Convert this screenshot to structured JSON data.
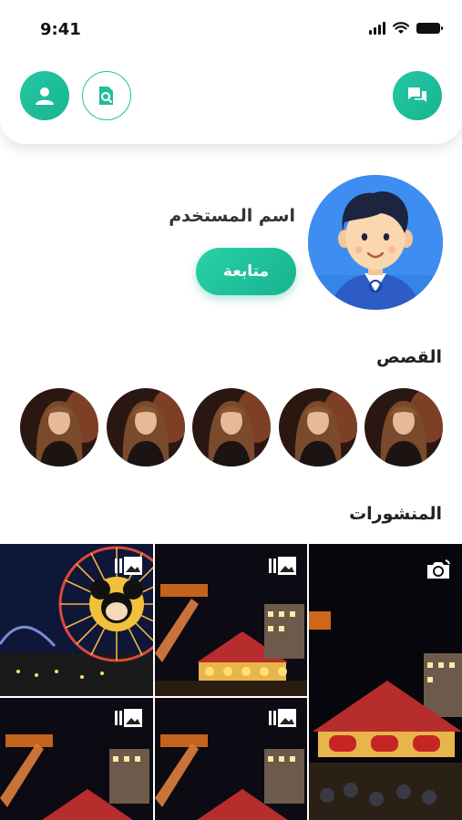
{
  "status_bar": {
    "time": "9:41"
  },
  "profile": {
    "username": "اسم المستخدم",
    "follow_label": "متابعة"
  },
  "stories": {
    "title": "القصص",
    "count": 5
  },
  "posts": {
    "title": "المنشورات"
  },
  "icons": {
    "user": "user-icon",
    "search": "search-document-icon",
    "chat": "chat-icon",
    "gallery": "gallery-icon",
    "camera": "camera-rotate-icon"
  },
  "colors": {
    "accent": "#1fbf98",
    "avatar_bg": "#3d8ef0"
  }
}
